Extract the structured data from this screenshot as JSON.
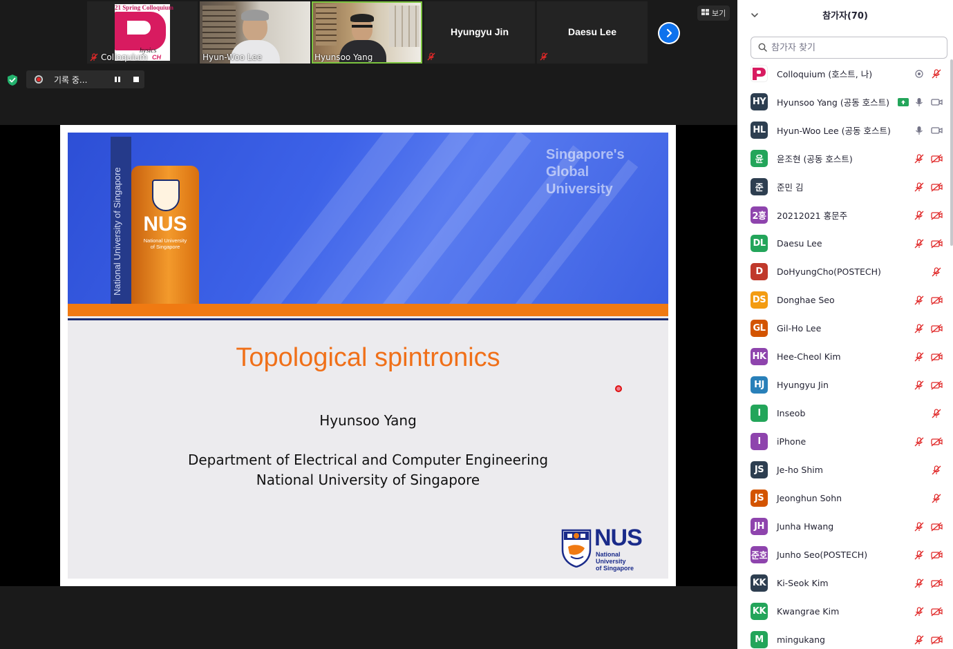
{
  "meeting": {
    "tiles": [
      {
        "name": "Colloquium",
        "logo_title": "21 Spring Colloquium",
        "logo_letter": "P",
        "logo_text": "hysics",
        "logo_brand": "CH",
        "muted": true,
        "video": true
      },
      {
        "name": "Hyun-Woo Lee",
        "muted": false,
        "video": true
      },
      {
        "name": "Hyunsoo Yang",
        "muted": false,
        "video": true,
        "active": true
      },
      {
        "name": "Hyungyu Jin",
        "muted": true,
        "video": false
      },
      {
        "name": "Daesu Lee",
        "muted": true,
        "video": false
      }
    ],
    "view_label": "보기",
    "recording_label": "기록 중...",
    "colors": {
      "active_border": "#7cc43f",
      "accent_blue": "#0e72ed",
      "mute_red": "#e02828",
      "shield_green": "#23b26d"
    }
  },
  "slide": {
    "tagline": [
      "Singapore's",
      "Global",
      "University"
    ],
    "sign_vertical_text": "National University of Singapore",
    "sign_word": "NUS",
    "sign_sub": [
      "National University",
      "of Singapore"
    ],
    "title": "Topological spintronics",
    "author": "Hyunsoo Yang",
    "department": "Department of Electrical and Computer Engineering",
    "institution": "National University of Singapore",
    "logo_word": "NUS",
    "logo_sub": [
      "National University",
      "of Singapore"
    ],
    "colors": {
      "banner": "#3d62e8",
      "orange": "#f07a12",
      "navy": "#1a2b6d",
      "title": "#f07019"
    }
  },
  "panel": {
    "title": "참가자(70)",
    "search_placeholder": "참가자 찾기",
    "participants": [
      {
        "initials": "P",
        "name": "Colloquium (호스트, 나)",
        "color": "#ffffff",
        "logo": true,
        "mic": "on-record",
        "cam": "none"
      },
      {
        "initials": "HY",
        "name": "Hyunsoo Yang (공동 호스트)",
        "color": "#2d3e50",
        "mic": "on",
        "cam": "on",
        "sharing": true
      },
      {
        "initials": "HL",
        "name": "Hyun-Woo Lee (공동 호스트)",
        "color": "#2d3e50",
        "mic": "on",
        "cam": "on"
      },
      {
        "initials": "윤",
        "name": "윤조현 (공동 호스트)",
        "color": "#23a55a",
        "mic": "off",
        "cam": "off"
      },
      {
        "initials": "준",
        "name": "준민 김",
        "color": "#2d3e50",
        "mic": "off",
        "cam": "off"
      },
      {
        "initials": "2홍",
        "name": "20212021 홍문주",
        "color": "#8e44ad",
        "mic": "off",
        "cam": "off"
      },
      {
        "initials": "DL",
        "name": "Daesu Lee",
        "color": "#23a55a",
        "mic": "off",
        "cam": "off"
      },
      {
        "initials": "D",
        "name": "DoHyungCho(POSTECH)",
        "color": "#c0392b",
        "mic": "off",
        "cam": "none"
      },
      {
        "initials": "DS",
        "name": "Donghae Seo",
        "color": "#f39c12",
        "mic": "off",
        "cam": "off"
      },
      {
        "initials": "GL",
        "name": "Gil-Ho Lee",
        "color": "#d35400",
        "mic": "off",
        "cam": "off"
      },
      {
        "initials": "HK",
        "name": "Hee-Cheol Kim",
        "color": "#8e44ad",
        "mic": "off",
        "cam": "off"
      },
      {
        "initials": "HJ",
        "name": "Hyungyu Jin",
        "color": "#2980b9",
        "mic": "off",
        "cam": "off"
      },
      {
        "initials": "I",
        "name": "Inseob",
        "color": "#23a55a",
        "mic": "off",
        "cam": "none"
      },
      {
        "initials": "I",
        "name": "iPhone",
        "color": "#8e44ad",
        "mic": "off",
        "cam": "off"
      },
      {
        "initials": "JS",
        "name": "Je-ho Shim",
        "color": "#2d3e50",
        "mic": "off",
        "cam": "none"
      },
      {
        "initials": "JS",
        "name": "Jeonghun Sohn",
        "color": "#d35400",
        "mic": "off",
        "cam": "none"
      },
      {
        "initials": "JH",
        "name": "Junha Hwang",
        "color": "#8e44ad",
        "mic": "off",
        "cam": "off"
      },
      {
        "initials": "준호",
        "name": "Junho Seo(POSTECH)",
        "color": "#8e44ad",
        "mic": "off",
        "cam": "off"
      },
      {
        "initials": "KK",
        "name": "Ki-Seok Kim",
        "color": "#2d3e50",
        "mic": "off",
        "cam": "off"
      },
      {
        "initials": "KK",
        "name": "Kwangrae Kim",
        "color": "#23a55a",
        "mic": "off",
        "cam": "off"
      },
      {
        "initials": "M",
        "name": "mingukang",
        "color": "#23a55a",
        "mic": "off",
        "cam": "off"
      }
    ]
  }
}
